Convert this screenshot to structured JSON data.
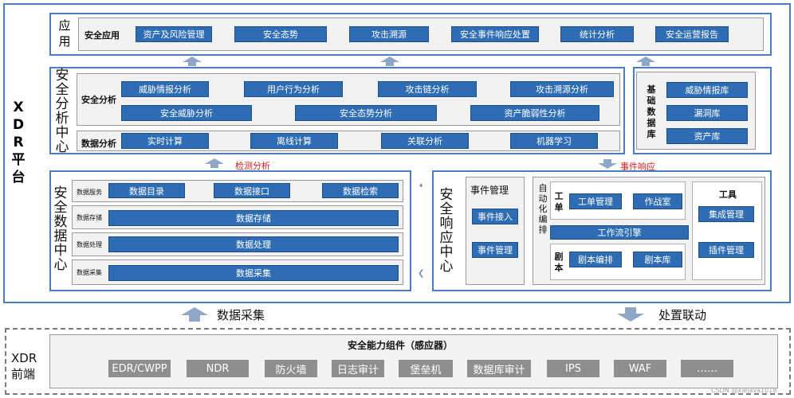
{
  "platform": {
    "title_chars": [
      "X",
      "D",
      "R",
      "平",
      "台"
    ]
  },
  "app_layer": {
    "title_chars": [
      "应",
      "用"
    ],
    "label": "安全应用",
    "items": [
      "资产及风险管理",
      "安全态势",
      "攻击溯源",
      "安全事件响应处置",
      "统计分析",
      "安全运营报告"
    ]
  },
  "analysis_center": {
    "title_chars": [
      "安",
      "全",
      "分",
      "析",
      "中",
      "心"
    ],
    "security_label": "安全分析",
    "security_row1": [
      "威胁情报分析",
      "用户行为分析",
      "攻击链分析",
      "攻击溯源分析"
    ],
    "security_row2": [
      "安全威胁分析",
      "安全态势分析",
      "资产脆弱性分析"
    ],
    "data_label": "数据分析",
    "data_items": [
      "实时计算",
      "离线计算",
      "关联分析",
      "机器学习"
    ]
  },
  "base_db": {
    "title_chars": [
      "基",
      "础",
      "数",
      "据",
      "库"
    ],
    "items": [
      "威胁情报库",
      "漏洞库",
      "资产库"
    ]
  },
  "flows": {
    "detect": "检测分析",
    "respond": "事件响应"
  },
  "data_center": {
    "title_chars": [
      "安",
      "全",
      "数",
      "据",
      "中",
      "心"
    ],
    "service_label": "数据服务",
    "service_items": [
      "数据目录",
      "数据接口",
      "数据检索"
    ],
    "storage_label": "数据存储",
    "storage_item": "数据存储",
    "process_label": "数据处理",
    "process_item": "数据处理",
    "collect_label": "数据采集",
    "collect_item": "数据采集"
  },
  "response_center": {
    "title_chars": [
      "安",
      "全",
      "响",
      "应",
      "中",
      "心"
    ],
    "event_mgmt_title": "事件管理",
    "event_items": [
      "事件接入",
      "事件管理"
    ],
    "orchestration_chars": [
      "自",
      "动",
      "化",
      "编",
      "排"
    ],
    "ticket_chars": [
      "工",
      "单"
    ],
    "ticket_items": [
      "工单管理",
      "作战室"
    ],
    "workflow": "工作流引擎",
    "playbook_chars": [
      "剧",
      "本"
    ],
    "playbook_items": [
      "剧本编排",
      "剧本库"
    ],
    "tools_title": "工具",
    "tools_items": [
      "集成管理",
      "插件管理"
    ]
  },
  "bottom_flows": {
    "collect": "数据采集",
    "linkage": "处置联动"
  },
  "frontend": {
    "title_line1": "XDR",
    "title_line2": "前端",
    "header": "安全能力组件（感应器）",
    "items": [
      "EDR/CWPP",
      "NDR",
      "防火墙",
      "日志审计",
      "堡垒机",
      "数据库审计",
      "IPS",
      "WAF",
      "……"
    ]
  },
  "watermark": "CSDN @xiejava1018",
  "colors": {
    "accent": "#2e6db4",
    "frame": "#4a7ebf",
    "flow_red": "#d11b1b"
  }
}
